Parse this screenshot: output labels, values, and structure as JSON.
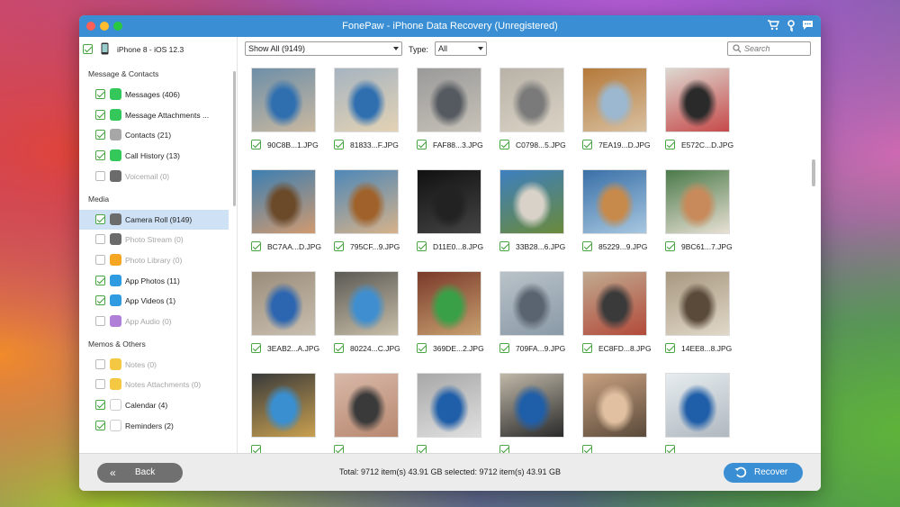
{
  "window": {
    "title": "FonePaw - iPhone Data Recovery (Unregistered)"
  },
  "titlebar_icons": [
    "cart-icon",
    "key-icon",
    "chat-icon"
  ],
  "sidebar": {
    "device": "iPhone 8 - iOS 12.3",
    "sections": [
      {
        "title": "Message & Contacts",
        "items": [
          {
            "label": "Messages (406)",
            "checked": true,
            "icon": "messages-icon",
            "color": "#34c759"
          },
          {
            "label": "Message Attachments ...",
            "checked": true,
            "icon": "message-attachments-icon",
            "color": "#34c759"
          },
          {
            "label": "Contacts (21)",
            "checked": true,
            "icon": "contacts-icon",
            "color": "#a7a7a7"
          },
          {
            "label": "Call History (13)",
            "checked": true,
            "icon": "phone-icon",
            "color": "#34c759"
          },
          {
            "label": "Voicemail (0)",
            "checked": false,
            "icon": "voicemail-icon",
            "color": "#6b6b6b",
            "disabled": true
          }
        ]
      },
      {
        "title": "Media",
        "items": [
          {
            "label": "Camera Roll (9149)",
            "checked": true,
            "icon": "camera-icon",
            "color": "#6b6b6b",
            "selected": true
          },
          {
            "label": "Photo Stream (0)",
            "checked": false,
            "icon": "photo-stream-icon",
            "color": "#6b6b6b",
            "disabled": true
          },
          {
            "label": "Photo Library (0)",
            "checked": false,
            "icon": "photo-library-icon",
            "color": "#f5a623",
            "disabled": true
          },
          {
            "label": "App Photos (11)",
            "checked": true,
            "icon": "app-photos-icon",
            "color": "#2f9be0"
          },
          {
            "label": "App Videos (1)",
            "checked": true,
            "icon": "app-videos-icon",
            "color": "#2f9be0"
          },
          {
            "label": "App Audio (0)",
            "checked": false,
            "icon": "app-audio-icon",
            "color": "#b07fd8",
            "disabled": true
          }
        ]
      },
      {
        "title": "Memos & Others",
        "items": [
          {
            "label": "Notes (0)",
            "checked": false,
            "icon": "notes-icon",
            "color": "#f4c842",
            "disabled": true
          },
          {
            "label": "Notes Attachments (0)",
            "checked": false,
            "icon": "notes-attachments-icon",
            "color": "#f4c842",
            "disabled": true
          },
          {
            "label": "Calendar (4)",
            "checked": true,
            "icon": "calendar-icon",
            "color": "#ffffff"
          },
          {
            "label": "Reminders (2)",
            "checked": true,
            "icon": "reminders-icon",
            "color": "#ffffff"
          }
        ]
      }
    ]
  },
  "toolbar": {
    "filter": "Show All (9149)",
    "type_label": "Type:",
    "type_value": "All",
    "search_placeholder": "Search"
  },
  "photos": [
    {
      "name": "90C8B...1.JPG",
      "palette": [
        "#6e8fa8",
        "#2f6fb0",
        "#c9b8a0"
      ]
    },
    {
      "name": "81833...F.JPG",
      "palette": [
        "#a6b4c0",
        "#2f6fb0",
        "#e3d2b4"
      ]
    },
    {
      "name": "FAF88...3.JPG",
      "palette": [
        "#9a9a9a",
        "#555a60",
        "#c7c2b8"
      ]
    },
    {
      "name": "C0798...5.JPG",
      "palette": [
        "#b8b2a8",
        "#7a7a7a",
        "#d9d2c4"
      ]
    },
    {
      "name": "7EA19...D.JPG",
      "palette": [
        "#b5793a",
        "#9bb8d0",
        "#d8c0a0"
      ]
    },
    {
      "name": "E572C...D.JPG",
      "palette": [
        "#ddd8d0",
        "#2a2a2a",
        "#c64a4a"
      ]
    },
    {
      "name": "BC7AA...D.JPG",
      "palette": [
        "#3d7fb2",
        "#6b4a2a",
        "#d09a70"
      ]
    },
    {
      "name": "795CF...9.JPG",
      "palette": [
        "#4e88b8",
        "#a0622a",
        "#d6b28a"
      ]
    },
    {
      "name": "D11E0...8.JPG",
      "palette": [
        "#111111",
        "#222222",
        "#444444"
      ]
    },
    {
      "name": "33B28...6.JPG",
      "palette": [
        "#3d7fc0",
        "#d8d2c8",
        "#6a8a3a"
      ]
    },
    {
      "name": "85229...9.JPG",
      "palette": [
        "#3a70a8",
        "#c88a4a",
        "#a7c7e0"
      ]
    },
    {
      "name": "9BC61...7.JPG",
      "palette": [
        "#4b7a4a",
        "#c88a5a",
        "#e8e0d4"
      ]
    },
    {
      "name": "3EAB2...A.JPG",
      "palette": [
        "#9b8d7a",
        "#2d66b0",
        "#c9bfb0"
      ]
    },
    {
      "name": "80224...C.JPG",
      "palette": [
        "#5c5a55",
        "#3f8fd0",
        "#c8bea8"
      ]
    },
    {
      "name": "369DE...2.JPG",
      "palette": [
        "#7a3a2a",
        "#3aa048",
        "#c8a070"
      ]
    },
    {
      "name": "709FA...9.JPG",
      "palette": [
        "#b9c2c8",
        "#5a6470",
        "#8a9aa8"
      ]
    },
    {
      "name": "EC8FD...8.JPG",
      "palette": [
        "#c0aa90",
        "#3a3a3a",
        "#b34a3a"
      ]
    },
    {
      "name": "14EE8...8.JPG",
      "palette": [
        "#a89880",
        "#5a4a3a",
        "#e0d8c8"
      ]
    },
    {
      "name": "",
      "palette": [
        "#3a3a3a",
        "#3a8fd0",
        "#c8a050"
      ]
    },
    {
      "name": "",
      "palette": [
        "#d8b8a8",
        "#3a3a3a",
        "#b88870"
      ]
    },
    {
      "name": "",
      "palette": [
        "#a8a8a8",
        "#1f5ea8",
        "#e0e0e0"
      ]
    },
    {
      "name": "",
      "palette": [
        "#c0b8a8",
        "#1f5ea8",
        "#2a2a2a"
      ]
    },
    {
      "name": "",
      "palette": [
        "#c8a080",
        "#e0c0a0",
        "#5a4a3a"
      ]
    },
    {
      "name": "",
      "palette": [
        "#e6ecef",
        "#1f5ea8",
        "#b0b8c0"
      ]
    }
  ],
  "footer": {
    "back_label": "Back",
    "totals": "Total: 9712 item(s) 43.91 GB   selected: 9712 item(s) 43.91 GB",
    "recover_label": "Recover"
  }
}
